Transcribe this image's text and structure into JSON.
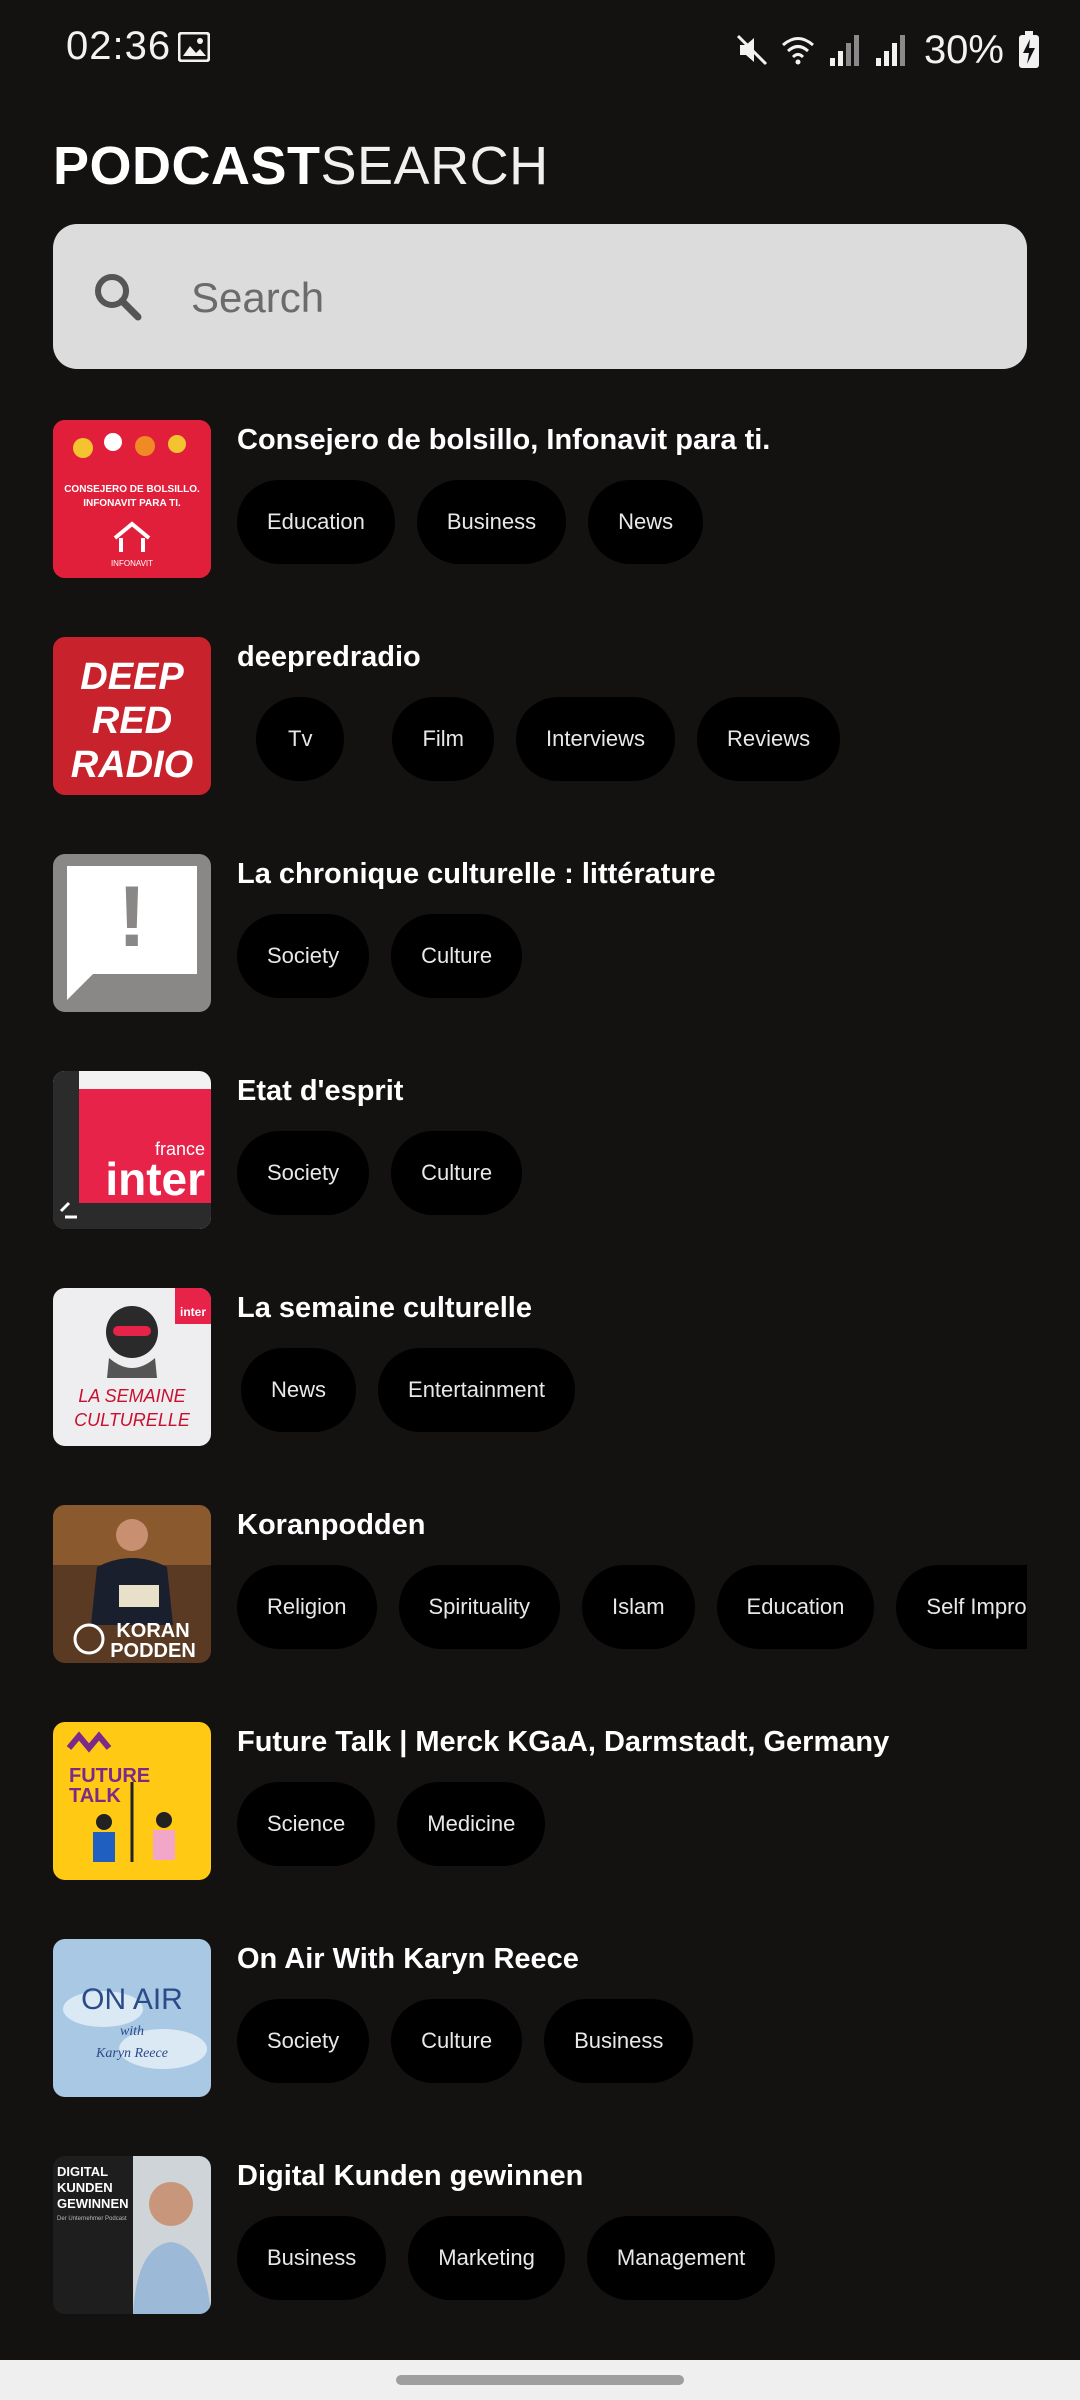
{
  "status": {
    "time": "02:36",
    "battery": "30%"
  },
  "app": {
    "title_bold": "PODCAST",
    "title_light": "SEARCH"
  },
  "search": {
    "placeholder": "Search",
    "value": ""
  },
  "podcasts": [
    {
      "title": "Consejero de bolsillo, Infonavit para ti.",
      "tags": [
        "Education",
        "Business",
        "News"
      ],
      "thumb_text": [
        "CONSEJERO DE BOLSILLO.",
        "INFONAVIT PARA TI.",
        "INFONAVIT"
      ]
    },
    {
      "title": "deepredradio",
      "tags": [
        "Tv",
        "Film",
        "Interviews",
        "Reviews"
      ],
      "thumb_text": [
        "DEEP",
        "RED",
        "RADIO"
      ]
    },
    {
      "title": "La chronique culturelle : littérature",
      "tags": [
        "Society",
        "Culture"
      ],
      "thumb_text": [
        "!"
      ]
    },
    {
      "title": "Etat d'esprit",
      "tags": [
        "Society",
        "Culture"
      ],
      "thumb_text": [
        "france",
        "inter"
      ]
    },
    {
      "title": "La semaine culturelle",
      "tags": [
        "News",
        "Entertainment"
      ],
      "thumb_text": [
        "LA SEMAINE",
        "CULTURELLE",
        "inter"
      ]
    },
    {
      "title": "Koranpodden",
      "tags": [
        "Religion",
        "Spirituality",
        "Islam",
        "Education",
        "Self Improvement"
      ],
      "thumb_text": [
        "KORAN",
        "PODDEN"
      ]
    },
    {
      "title": "Future Talk | Merck KGaA, Darmstadt, Germany",
      "tags": [
        "Science",
        "Medicine"
      ],
      "thumb_text": [
        "FUTURE",
        "TALK"
      ]
    },
    {
      "title": "On Air With Karyn Reece",
      "tags": [
        "Society",
        "Culture",
        "Business"
      ],
      "thumb_text": [
        "ON AIR",
        "with",
        "Karyn Reece"
      ]
    },
    {
      "title": "Digital Kunden gewinnen",
      "tags": [
        "Business",
        "Marketing",
        "Management"
      ],
      "thumb_text": [
        "DIGITAL",
        "KUNDEN",
        "GEWINNEN",
        "Der Unternehmer Podcast"
      ]
    }
  ]
}
